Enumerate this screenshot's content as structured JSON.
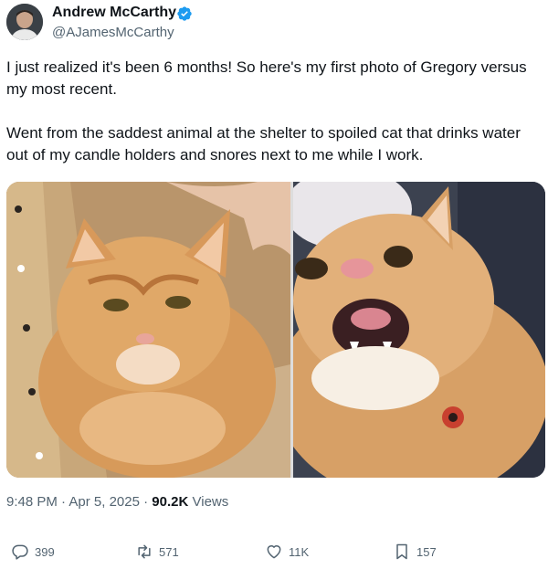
{
  "author": {
    "name": "Andrew McCarthy",
    "handle": "@AJamesMcCarthy",
    "verified": true
  },
  "post": {
    "paragraphs": [
      "I just realized it's been 6 months! So here's my first photo of Gregory versus my most recent.",
      "Went from the saddest animal at the shelter to spoiled cat that drinks water out of my candle holders and snores next to me while I work."
    ]
  },
  "media": {
    "count": 2
  },
  "meta": {
    "time": "9:48 PM",
    "separator": "·",
    "date": "Apr 5, 2025",
    "views_count": "90.2K",
    "views_label": "Views"
  },
  "actions": {
    "replies": "399",
    "reposts": "571",
    "likes": "11K",
    "bookmarks": "157"
  },
  "icons": {
    "reply": "reply-icon",
    "repost": "repost-icon",
    "like": "heart-icon",
    "bookmark": "bookmark-icon",
    "verified": "verified-badge-icon"
  },
  "colors": {
    "text": "#0f1419",
    "secondary": "#536471",
    "verified": "#1d9bf0"
  }
}
